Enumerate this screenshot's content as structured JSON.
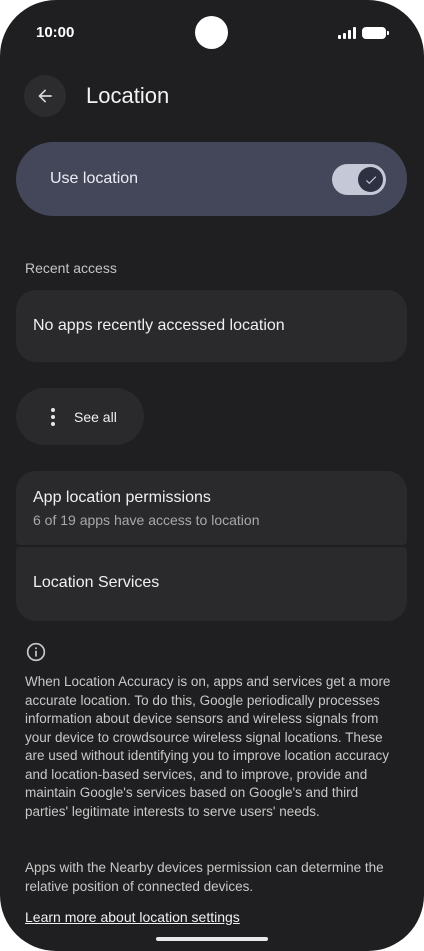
{
  "status_bar": {
    "time": "10:00"
  },
  "header": {
    "title": "Location",
    "back_icon": "arrow-left-icon"
  },
  "use_location": {
    "label": "Use location",
    "enabled": true
  },
  "recent_access": {
    "section_label": "Recent access",
    "empty_text": "No apps recently accessed location",
    "see_all_label": "See all"
  },
  "app_permissions": {
    "title": "App location permissions",
    "subtitle": "6 of 19 apps have access to location"
  },
  "location_services": {
    "title": "Location Services"
  },
  "info": {
    "icon": "info-icon",
    "accuracy_text": "When Location Accuracy is on, apps and services get a more accurate location. To do this, Google periodically processes information about device sensors and wireless signals from your device to crowdsource wireless signal locations. These are used without identifying you to improve location accuracy and location-based services, and to improve, provide and maintain Google's services based on Google's and third parties' legitimate interests to serve users' needs.",
    "nearby_text": "Apps with the Nearby devices permission can determine the relative position of connected devices.",
    "learn_more": "Learn more about location settings"
  },
  "colors": {
    "background": "#1f1f21",
    "toggle_card": "#44475a",
    "card": "#2a2a2d",
    "toggle_track": "#c5c8d6"
  }
}
